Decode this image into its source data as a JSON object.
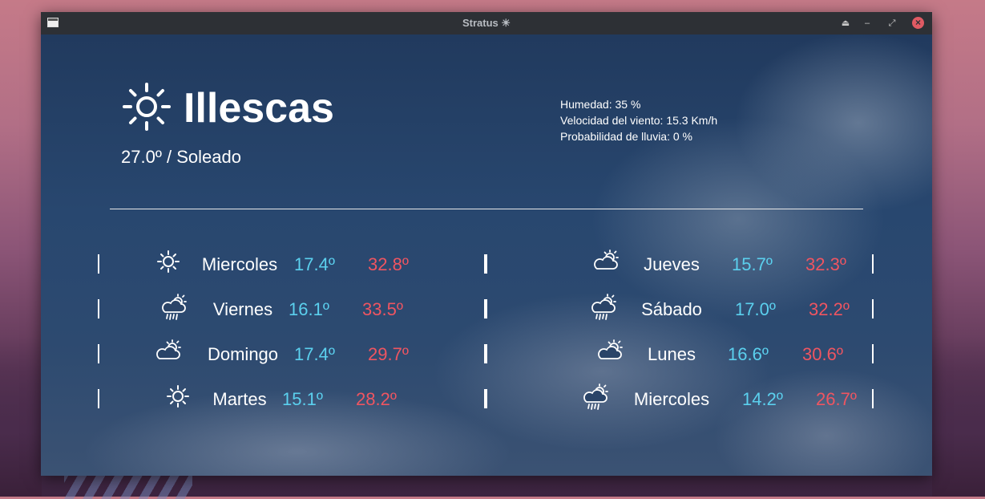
{
  "window": {
    "title": "Stratus ☀"
  },
  "current": {
    "icon": "sun-icon",
    "city": "Illescas",
    "summary": "27.0º / Soleado",
    "humidity": "Humedad: 35 %",
    "wind": "Velocidad del viento: 15.3 Km/h",
    "rain": "Probabilidad de lluvia: 0 %"
  },
  "forecast_left": [
    {
      "icon": "sun-icon",
      "day": "Miercoles",
      "min": "17.4º",
      "max": "32.8º"
    },
    {
      "icon": "sun-cloud-rain-icon",
      "day": "Viernes",
      "min": "16.1º",
      "max": "33.5º"
    },
    {
      "icon": "sun-cloud-icon",
      "day": "Domingo",
      "min": "17.4º",
      "max": "29.7º"
    },
    {
      "icon": "sun-icon",
      "day": "Martes",
      "min": "15.1º",
      "max": "28.2º"
    }
  ],
  "forecast_right": [
    {
      "icon": "sun-cloud-icon",
      "day": "Jueves",
      "min": "15.7º",
      "max": "32.3º"
    },
    {
      "icon": "sun-cloud-rain-icon",
      "day": "Sábado",
      "min": "17.0º",
      "max": "32.2º"
    },
    {
      "icon": "sun-cloud-icon",
      "day": "Lunes",
      "min": "16.6º",
      "max": "30.6º"
    },
    {
      "icon": "sun-cloud-rain-icon",
      "day": "Miercoles",
      "min": "14.2º",
      "max": "26.7º"
    }
  ],
  "colors": {
    "min": "#5bd0ee",
    "max": "#ef5561",
    "close": "#e05a63"
  }
}
